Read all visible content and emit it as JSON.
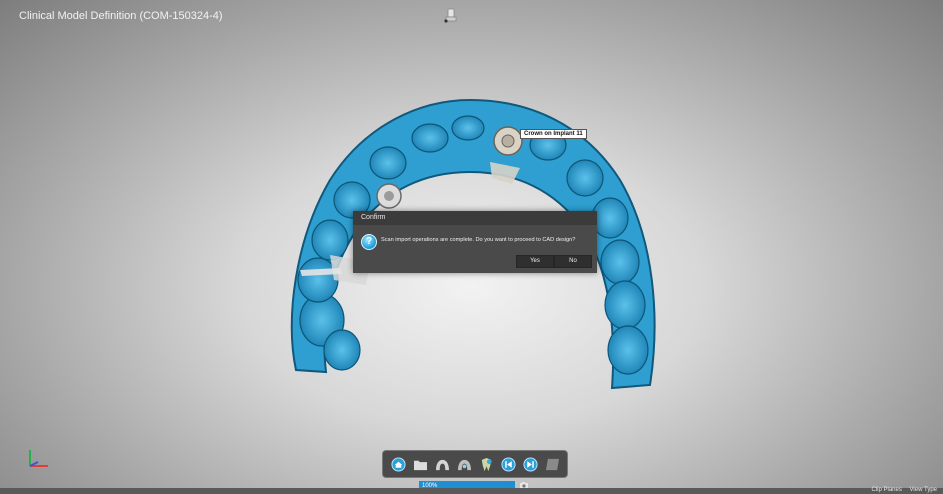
{
  "window": {
    "title": "Clinical Model Definition (COM-150324-4)"
  },
  "viewport": {
    "callout_label": "Crown on Implant 11",
    "scan_color": "#2e9fd0"
  },
  "dialog": {
    "title": "Confirm",
    "message": "Scan import operations are complete. Do you want to proceed to CAD design?",
    "yes_label": "Yes",
    "no_label": "No",
    "icon": "question-icon"
  },
  "toolbar": {
    "buttons": [
      {
        "icon": "home-icon"
      },
      {
        "icon": "folder-icon"
      },
      {
        "icon": "upper-jaw-icon"
      },
      {
        "icon": "lower-jaw-icon"
      },
      {
        "icon": "teeth-icon"
      },
      {
        "icon": "previous-icon"
      },
      {
        "icon": "next-icon"
      },
      {
        "icon": "layer-icon"
      }
    ]
  },
  "status": {
    "progress_label": "100%",
    "progress": 1.0,
    "clip_planes_label": "Clip Planes",
    "view_type_label": "View Type"
  }
}
